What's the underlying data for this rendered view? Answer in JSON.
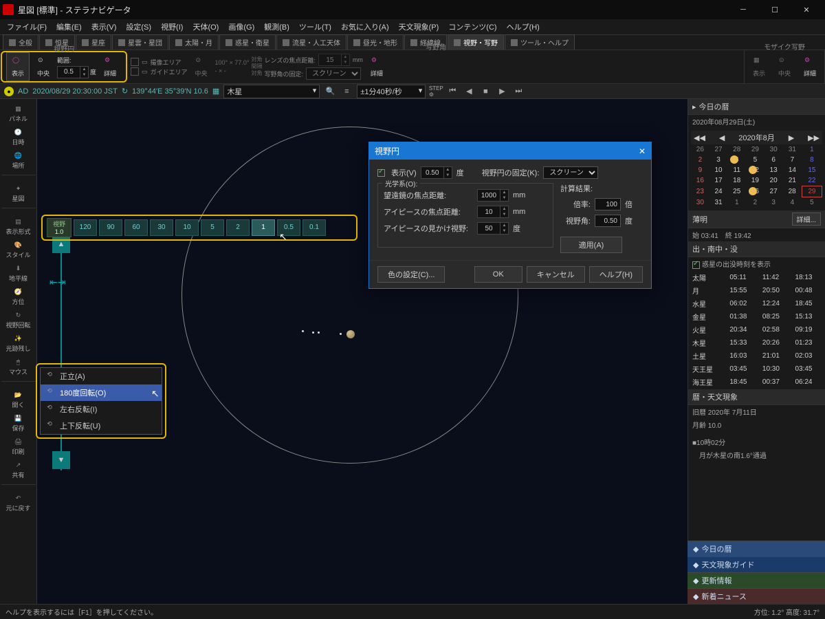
{
  "title": "星図 [標準] - ステラナビゲータ",
  "menu": [
    "ファイル(F)",
    "編集(E)",
    "表示(V)",
    "設定(S)",
    "視野(I)",
    "天体(O)",
    "画像(G)",
    "観測(B)",
    "ツール(T)",
    "お気に入り(A)",
    "天文現象(P)",
    "コンテンツ(C)",
    "ヘルプ(H)"
  ],
  "tabs": [
    "全般",
    "恒星",
    "星座",
    "星雲・星団",
    "太陽・月",
    "惑星・衛星",
    "流星・人工天体",
    "昼光・地形",
    "経緯線",
    "視野・写野",
    "ツール・ヘルプ"
  ],
  "activeTab": 9,
  "ribbon": {
    "group1": {
      "label": "視野円",
      "show": "表示",
      "center": "中央",
      "range": "範囲:",
      "rangeVal": "0.5",
      "unit": "度",
      "detail": "詳細"
    },
    "group2": {
      "label": "写野角",
      "imgarea": "撮像エリア",
      "guide": "ガイドエリア",
      "center": "中央",
      "dims": "100° × 77.0°",
      "diag": "対角\n間隔\n対角",
      "lens": "レンズの焦点距離:",
      "lensVal": "15",
      "lensUnit": "mm",
      "fix": "写野角の固定:",
      "fixVal": "スクリーン",
      "detail": "詳細"
    },
    "group3": {
      "label": "モザイク写野",
      "show": "表示",
      "center": "中央",
      "detail": "詳細"
    }
  },
  "datebar": {
    "ad": "AD",
    "date": "2020/08/29 20:30:00 JST",
    "loc": "139°44'E 35°39'N 10.6",
    "target": "木星",
    "step": "±1分40秒/秒"
  },
  "leftbar": [
    "パネル",
    "日時",
    "場所",
    "",
    "星図",
    "",
    "表示形式",
    "スタイル",
    "地平線",
    "方位",
    "視野回転",
    "光跡残し",
    "マウス",
    "",
    "開く",
    "保存",
    "印刷",
    "共有",
    "",
    "元に戻す"
  ],
  "fov": {
    "label": "視野",
    "cur": "1.0",
    "buttons": [
      "120",
      "90",
      "60",
      "30",
      "10",
      "5",
      "2",
      "1",
      "0.5",
      "0.1"
    ],
    "active": "1"
  },
  "rotmenu": [
    "正立(A)",
    "180度回転(O)",
    "左右反転(I)",
    "上下反転(U)"
  ],
  "dialog": {
    "title": "視野円",
    "show": "表示(V)",
    "showVal": "0.50",
    "showUnit": "度",
    "fix": "視野円の固定(K):",
    "fixVal": "スクリーン",
    "optics": "光学系(O):",
    "telFL": "望遠鏡の焦点距離:",
    "telFLVal": "1000",
    "telFLUnit": "mm",
    "epFL": "アイピースの焦点距離:",
    "epFLVal": "10",
    "epFLUnit": "mm",
    "epFOV": "アイピースの見かけ視野:",
    "epFOVVal": "50",
    "epFOVUnit": "度",
    "calc": "計算結果:",
    "mag": "倍率:",
    "magVal": "100",
    "magUnit": "倍",
    "fov": "視野角:",
    "fovVal": "0.50",
    "fovUnit": "度",
    "apply": "適用(A)",
    "color": "色の設定(C)...",
    "ok": "OK",
    "cancel": "キャンセル",
    "help": "ヘルプ(H)"
  },
  "almanac": {
    "title": "今日の暦",
    "date": "2020年08月29日(土)",
    "month": "2020年8月",
    "twilight": {
      "label": "薄明",
      "start": "始 03:41",
      "end": "終 19:42",
      "detail": "詳細..."
    },
    "rise": {
      "label": "出・南中・没",
      "chk": "惑星の出没時刻を表示",
      "rows": [
        [
          "太陽",
          "05:11",
          "11:42",
          "18:13"
        ],
        [
          "月",
          "15:55",
          "20:50",
          "00:48"
        ],
        [
          "水星",
          "06:02",
          "12:24",
          "18:45"
        ],
        [
          "金星",
          "01:38",
          "08:25",
          "15:13"
        ],
        [
          "火星",
          "20:34",
          "02:58",
          "09:19"
        ],
        [
          "木星",
          "15:33",
          "20:26",
          "01:23"
        ],
        [
          "土星",
          "16:03",
          "21:01",
          "02:03"
        ],
        [
          "天王星",
          "03:45",
          "10:30",
          "03:45"
        ],
        [
          "海王星",
          "18:45",
          "00:37",
          "06:24"
        ]
      ]
    },
    "events": {
      "label": "暦・天文現象",
      "lunar": "旧暦 2020年 7月11日",
      "age": "月齢 10.0",
      "ev1": "■10時02分",
      "ev2": "　月が木星の南1.6°通過"
    },
    "tabs": [
      "今日の暦",
      "天文現象ガイド",
      "更新情報",
      "新着ニュース"
    ]
  },
  "status": {
    "help": "ヘルプを表示するには［F1］を押してください。",
    "pos": "方位: 1.2° 高度: 31.7°"
  }
}
